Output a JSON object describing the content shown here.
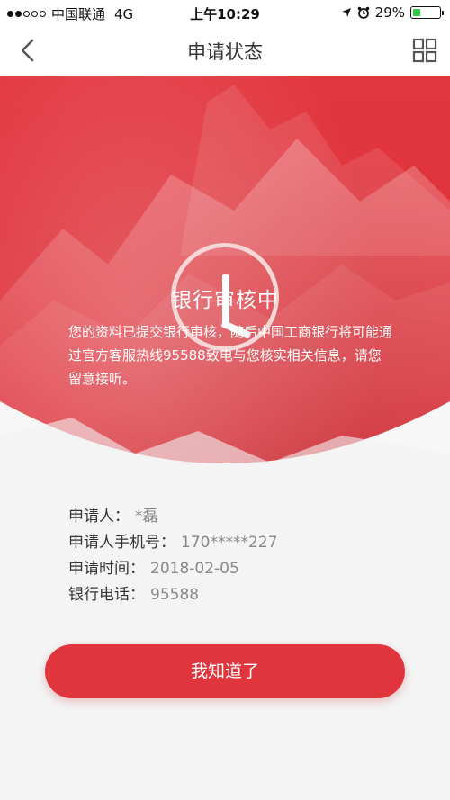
{
  "status_bar": {
    "carrier": "中国联通",
    "network": "4G",
    "time": "上午10:29",
    "battery": "29%",
    "battery_level": 0.29
  },
  "nav": {
    "title": "申请状态",
    "back_icon": "chevron-left-icon",
    "menu_icon": "grid-icon"
  },
  "status": {
    "icon": "clock-icon",
    "title": "银行审核中",
    "description": "您的资料已提交银行审核，随后中国工商银行将可能通过官方客服热线95588致电与您核实相关信息，请您留意接听。"
  },
  "info": {
    "applicant_label": "申请人：",
    "applicant_value": "*磊",
    "phone_label": "申请人手机号：",
    "phone_value": "170*****227",
    "time_label": "申请时间：",
    "time_value": "2018-02-05",
    "bank_phone_label": "银行电话：",
    "bank_phone_value": "95588"
  },
  "button": {
    "label": "我知道了"
  },
  "colors": {
    "brand_red": "#e0353c",
    "background": "#f7f7f7"
  }
}
